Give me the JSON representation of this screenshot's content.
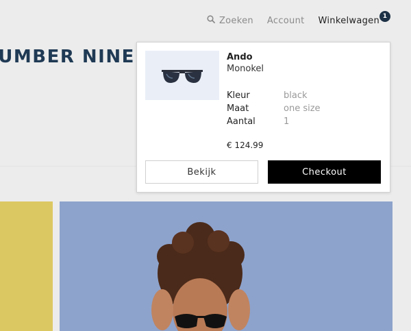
{
  "header": {
    "search_label": "Zoeken",
    "account_label": "Account",
    "cart_label": "Winkelwagen",
    "cart_count": "1",
    "badge_color": "#1d3146"
  },
  "brand": {
    "title": "NUMBER NINE"
  },
  "cart_dropdown": {
    "item": {
      "name": "Ando",
      "brand": "Monokel",
      "attributes": [
        {
          "label": "Kleur",
          "value": "black"
        },
        {
          "label": "Maat",
          "value": "one size"
        },
        {
          "label": "Aantal",
          "value": "1"
        }
      ],
      "price": "€ 124.99",
      "image_icon": "sunglasses-icon"
    },
    "view_button_label": "Bekijk",
    "checkout_button_label": "Checkout"
  },
  "colors": {
    "brand_text": "#1f3a54",
    "checkout_bg": "#000000",
    "yellow_panel": "#dcc862",
    "photo_bg": "#8da3cc"
  }
}
